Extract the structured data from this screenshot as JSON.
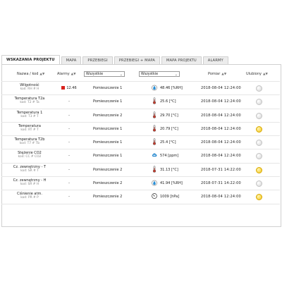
{
  "tabs": [
    {
      "label": "WSKAZANIA PROJEKTU",
      "active": true
    },
    {
      "label": "MAPA",
      "active": false
    },
    {
      "label": "PRZEBIEGI",
      "active": false
    },
    {
      "label": "PRZEBIEGI + MAPA",
      "active": false
    },
    {
      "label": "MAPA PROJEKTU",
      "active": false
    },
    {
      "label": "ALARMY",
      "active": false
    }
  ],
  "headers": {
    "name": "Nazwa / kod",
    "name_sort": "▲▼",
    "alarm": "Alarmy",
    "alarm_sort": "▲▼",
    "location_filter": "Wszystkie",
    "value_filter": "Wszystkie",
    "measured": "Pomiar",
    "measured_sort": "▲▼",
    "favourite": "Ulubiony",
    "favourite_sort": "▲▼"
  },
  "rows": [
    {
      "name": "Wilgotność",
      "code": "kod: RH # H",
      "alarm": "12.46",
      "alarm_active": true,
      "location": "Pomieszczenie 1",
      "icon": "humidity-drop-icon",
      "value": "48.46 [%RH]",
      "time": "2018-08-04 12:24:00",
      "favourite": false
    },
    {
      "name": "Temperatura T2a",
      "code": "kod: T2 # Ta",
      "alarm": "-",
      "alarm_active": false,
      "location": "Pomieszczenie 1",
      "icon": "thermometer-icon",
      "value": "25.6 [°C]",
      "time": "2018-08-04 12:24:00",
      "favourite": false
    },
    {
      "name": "Temperatura 1",
      "code": "kod: T3 # T",
      "alarm": "-",
      "alarm_active": false,
      "location": "Pomieszczenie 2",
      "icon": "thermometer-icon",
      "value": "29.70 [°C]",
      "time": "2018-08-04 12:24:00",
      "favourite": false
    },
    {
      "name": "Temperatura",
      "code": "kod: RT # T",
      "alarm": "-",
      "alarm_active": false,
      "location": "Pomieszczenie 1",
      "icon": "thermometer-icon",
      "value": "20.79 [°C]",
      "time": "2018-08-04 12:24:00",
      "favourite": true
    },
    {
      "name": "Temperatura T2b",
      "code": "kod: T7 # Tb",
      "alarm": "-",
      "alarm_active": false,
      "location": "Pomieszczenie 1",
      "icon": "thermometer-icon",
      "value": "25.4 [°C]",
      "time": "2018-08-04 12:24:00",
      "favourite": false
    },
    {
      "name": "Stężenie CO2",
      "code": "kod: CC # CO2",
      "alarm": "-",
      "alarm_active": false,
      "location": "Pomieszczenie 1",
      "icon": "co2-cloud-icon",
      "value": "574 [ppm]",
      "time": "2018-08-04 12:24:00",
      "favourite": false
    },
    {
      "name": "Cz. zewnętrzny - T",
      "code": "kod: SR # T",
      "alarm": "-",
      "alarm_active": false,
      "location": "Pomieszczenie 2",
      "icon": "thermometer-icon",
      "value": "31.13 [°C]",
      "time": "2018-07-31 14:22:00",
      "favourite": true
    },
    {
      "name": "Cz. zewnętrzny - H",
      "code": "kod: SR # H",
      "alarm": "-",
      "alarm_active": false,
      "location": "Pomieszczenie 2",
      "icon": "humidity-drop-icon",
      "value": "41.94 [%RH]",
      "time": "2018-07-31 14:22:00",
      "favourite": false
    },
    {
      "name": "Ciśnienie atm.",
      "code": "kod: PR # P",
      "alarm": "-",
      "alarm_active": false,
      "location": "Pomieszczenie 2",
      "icon": "pressure-gauge-icon",
      "value": "1009 [hPa]",
      "time": "2018-08-04 12:24:00",
      "favourite": true
    }
  ],
  "colors": {
    "alarm_red": "#d9221d",
    "favourite_on": "#f3c51c",
    "humidity_blue": "#2a8fd6"
  }
}
